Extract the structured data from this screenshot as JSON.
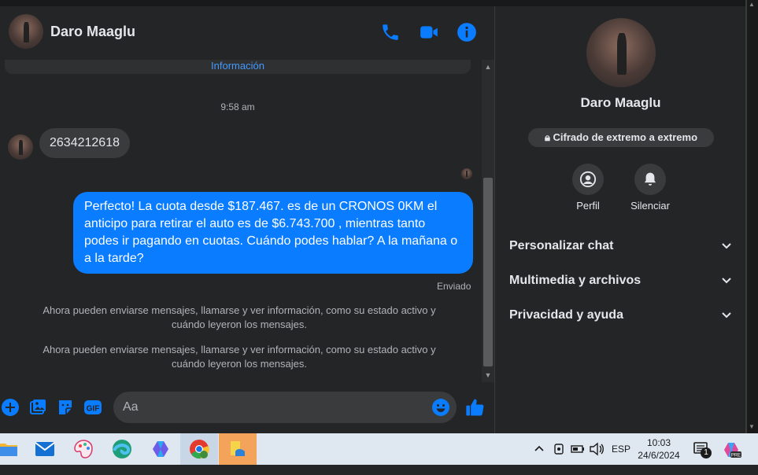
{
  "header": {
    "contact_name": "Daro Maaglu",
    "icons": [
      "phone-icon",
      "video-icon",
      "info-icon"
    ]
  },
  "messages": {
    "prev_link": "Información",
    "time_separator": "9:58 am",
    "incoming_text": "2634212618",
    "outgoing_text": "Perfecto! La cuota desde $187.467. es de un CRONOS 0KM el anticipo para retirar el auto es de $6.743.700 , mientras tanto podes ir pagando en cuotas. Cuándo podes hablar? A la mañana o a la tarde?",
    "sent_status": "Enviado",
    "system_1": "Ahora pueden enviarse mensajes, llamarse y ver información, como su estado activo y cuándo leyeron los mensajes.",
    "system_2": "Ahora pueden enviarse mensajes, llamarse y ver información, como su estado activo y cuándo leyeron los mensajes."
  },
  "composer": {
    "placeholder": "Aa",
    "icons": [
      "plus-icon",
      "image-icon",
      "sticker-icon",
      "gif-icon",
      "emoji-icon",
      "like-icon"
    ],
    "gif_label": "GIF"
  },
  "right_panel": {
    "name": "Daro Maaglu",
    "encryption_label": "Cifrado de extremo a extremo",
    "actions": [
      {
        "label": "Perfil",
        "icon": "profile-icon"
      },
      {
        "label": "Silenciar",
        "icon": "bell-icon"
      }
    ],
    "sections": [
      {
        "label": "Personalizar chat"
      },
      {
        "label": "Multimedia y archivos"
      },
      {
        "label": "Privacidad y ayuda"
      }
    ]
  },
  "taskbar": {
    "language": "ESP",
    "time": "10:03",
    "date": "24/6/2024",
    "notification_count": "1",
    "apps": [
      "file-explorer-icon",
      "mail-icon",
      "paint-icon",
      "edge-icon",
      "copilot-icon",
      "chrome-icon",
      "files-icon"
    ]
  },
  "colors": {
    "accent": "#0a7cff",
    "background": "#242526",
    "bubble_in": "#3a3b3c",
    "taskbar": "#dfe7f1"
  }
}
